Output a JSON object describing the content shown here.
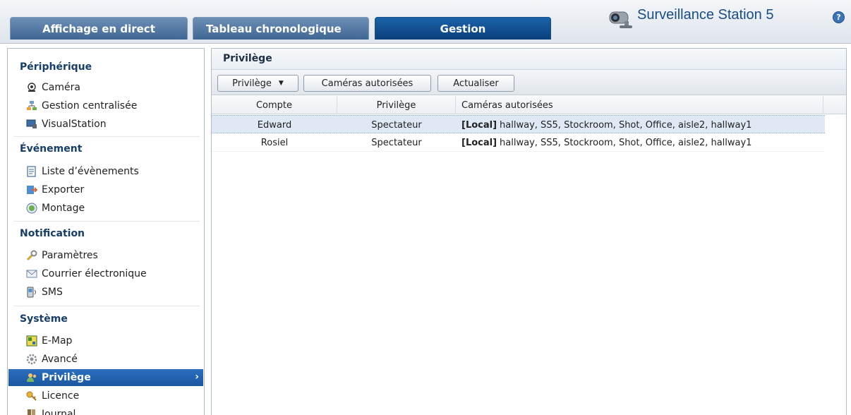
{
  "tabs": [
    {
      "label": "Affichage en direct"
    },
    {
      "label": "Tableau chronologique"
    },
    {
      "label": "Gestion"
    }
  ],
  "app": {
    "title": "Surveillance Station 5",
    "help": "?"
  },
  "sidebar": {
    "sections": [
      {
        "title": "Périphérique",
        "items": [
          {
            "label": "Caméra",
            "icon": "camera-icon"
          },
          {
            "label": "Gestion centralisée",
            "icon": "network-icon"
          },
          {
            "label": "VisualStation",
            "icon": "monitor-icon"
          }
        ]
      },
      {
        "title": "Événement",
        "items": [
          {
            "label": "Liste d’évènements",
            "icon": "list-icon"
          },
          {
            "label": "Exporter",
            "icon": "export-icon"
          },
          {
            "label": "Montage",
            "icon": "montage-icon"
          }
        ]
      },
      {
        "title": "Notification",
        "items": [
          {
            "label": "Paramètres",
            "icon": "wrench-icon"
          },
          {
            "label": "Courrier électronique",
            "icon": "mail-icon"
          },
          {
            "label": "SMS",
            "icon": "sms-icon"
          }
        ]
      },
      {
        "title": "Système",
        "items": [
          {
            "label": "E-Map",
            "icon": "map-icon"
          },
          {
            "label": "Avancé",
            "icon": "gear-icon"
          },
          {
            "label": "Privilège",
            "icon": "users-icon",
            "selected": true
          },
          {
            "label": "Licence",
            "icon": "key-icon"
          },
          {
            "label": "Journal",
            "icon": "journal-icon"
          }
        ]
      }
    ]
  },
  "panel": {
    "title": "Privilège",
    "toolbar": {
      "privilege_label": "Privilège",
      "cameras_label": "Caméras autorisées",
      "refresh_label": "Actualiser"
    },
    "columns": [
      "Compte",
      "Privilège",
      "Caméras autorisées"
    ],
    "rows": [
      {
        "account": "Edward",
        "privilege": "Spectateur",
        "scope": "[Local]",
        "cameras": "hallway, SS5, Stockroom, Shot, Office, aisle2, hallway1"
      },
      {
        "account": "Rosiel",
        "privilege": "Spectateur",
        "scope": "[Local]",
        "cameras": "hallway, SS5, Stockroom, Shot, Office, aisle2, hallway1"
      }
    ]
  },
  "colors": {
    "active_tab": "#0b3f7c",
    "selected_nav": "#1a57a0",
    "row_selected": "#dfe9f6"
  }
}
